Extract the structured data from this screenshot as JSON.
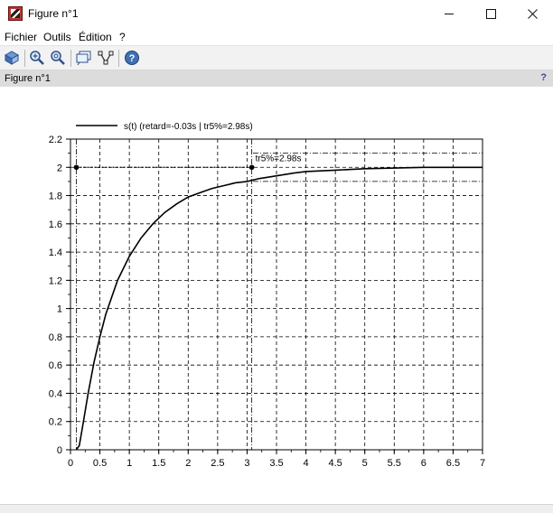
{
  "window": {
    "title": "Figure n°1",
    "icon": "scilab-figure-icon"
  },
  "menu": {
    "items": [
      "Fichier",
      "Outils",
      "Édition",
      "?"
    ]
  },
  "toolbar": {
    "tools": [
      "rotate-icon",
      "zoom-in-icon",
      "zoom-out-icon",
      "datatip-icon",
      "editor-icon",
      "help-icon"
    ]
  },
  "panel": {
    "title": "Figure n°1",
    "help": "?"
  },
  "chart_data": {
    "type": "line",
    "legend": [
      "s(t) (retard=-0.03s | tr5%=2.98s)"
    ],
    "legend_position": "top-left",
    "annotation": "tr5%=2.98s",
    "xlim": [
      0,
      7
    ],
    "ylim": [
      0,
      2.2
    ],
    "xticks": [
      "0",
      "0.5",
      "1",
      "1.5",
      "2",
      "2.5",
      "3",
      "3.5",
      "4",
      "4.5",
      "5",
      "5.5",
      "6",
      "6.5",
      "7"
    ],
    "yticks": [
      "0",
      "0.2",
      "0.4",
      "0.6",
      "0.8",
      "1",
      "1.2",
      "1.4",
      "1.6",
      "1.8",
      "2",
      "2.2"
    ],
    "grid": true,
    "series": [
      {
        "name": "s(t) (retard=-0.03s | tr5%=2.98s)",
        "x": [
          0.1,
          0.15,
          0.2,
          0.3,
          0.4,
          0.5,
          0.6,
          0.8,
          1.0,
          1.2,
          1.4,
          1.6,
          1.8,
          2.0,
          2.2,
          2.4,
          2.6,
          2.8,
          3.0,
          3.2,
          3.5,
          3.8,
          4.0,
          4.5,
          5.0,
          5.5,
          6.0,
          6.5,
          7.0
        ],
        "y": [
          0.0,
          0.03,
          0.15,
          0.4,
          0.62,
          0.8,
          0.96,
          1.2,
          1.37,
          1.5,
          1.6,
          1.68,
          1.74,
          1.79,
          1.82,
          1.85,
          1.87,
          1.89,
          1.9,
          1.92,
          1.94,
          1.96,
          1.97,
          1.98,
          1.99,
          1.995,
          2.0,
          2.0,
          2.0
        ]
      }
    ],
    "markers": [
      {
        "x": 0.1,
        "y": 2.0
      },
      {
        "x": 3.08,
        "y": 2.0
      }
    ],
    "steady_value": 2.0,
    "band_upper": 2.1,
    "band_lower": 1.9,
    "vertical_lines": [
      0.1,
      3.08
    ]
  },
  "colors": {
    "curve": "#000000",
    "grid": "#000000",
    "panel_header": "#dcdcdc"
  }
}
